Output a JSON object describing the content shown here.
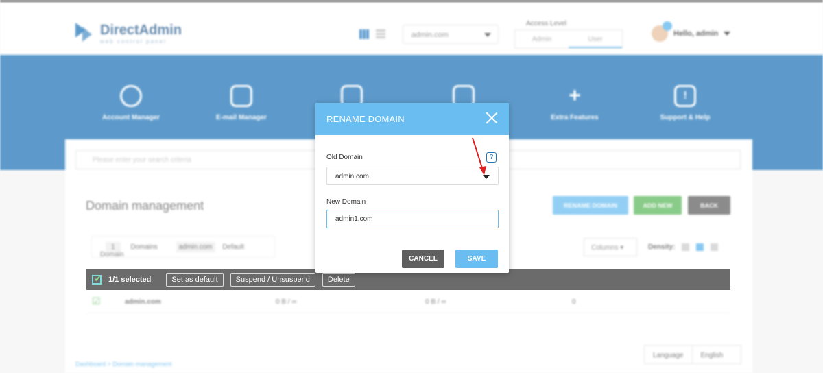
{
  "header": {
    "brand_name": "DirectAdmin",
    "brand_tagline": "web control panel",
    "domain_selector_value": "admin.com",
    "access_level": {
      "title": "Access Level",
      "options": [
        "Admin",
        "User"
      ],
      "active": "User"
    },
    "user_greeting": "Hello, admin"
  },
  "nav": {
    "items": [
      {
        "label": "Account Manager",
        "icon": "user-icon"
      },
      {
        "label": "E-mail Manager",
        "icon": "envelope-icon"
      },
      {
        "label": "",
        "icon": "document-icon"
      },
      {
        "label": "",
        "icon": "folder-icon"
      },
      {
        "label": "Extra Features",
        "icon": "plus-icon"
      },
      {
        "label": "Support & Help",
        "icon": "exclamation-icon"
      }
    ]
  },
  "page": {
    "search_placeholder": "Please enter your search criteria",
    "title": "Domain management",
    "buttons": {
      "rename": "RENAME DOMAIN",
      "add_new": "ADD NEW",
      "back": "BACK"
    },
    "stats": {
      "count": "1",
      "count_label": "Domains",
      "default_domain": "admin.com",
      "default_label": "Default Domain"
    },
    "columns_label": "Columns",
    "density_label": "Density:",
    "selection": {
      "text": "1/1 selected",
      "set_default": "Set as default",
      "suspend": "Suspend / Unsuspend",
      "delete": "Delete"
    },
    "row": {
      "domain": "admin.com",
      "col2": "0 B / ∞",
      "col3": "0 B / ∞",
      "col4": "0"
    },
    "breadcrumb": "Dashboard > Domain management",
    "language": {
      "label": "Language",
      "value": "English"
    }
  },
  "modal": {
    "title": "RENAME DOMAIN",
    "old_domain_label": "Old Domain",
    "help_label": "?",
    "old_domain_value": "admin.com",
    "new_domain_label": "New Domain",
    "new_domain_value": "admin1.com",
    "cancel_label": "CANCEL",
    "save_label": "SAVE"
  },
  "colors": {
    "primary_blue": "#1f74b8",
    "accent_blue": "#6abdf0",
    "green": "#5cb85c",
    "dark": "#333333",
    "annotation_red": "#e02020"
  }
}
